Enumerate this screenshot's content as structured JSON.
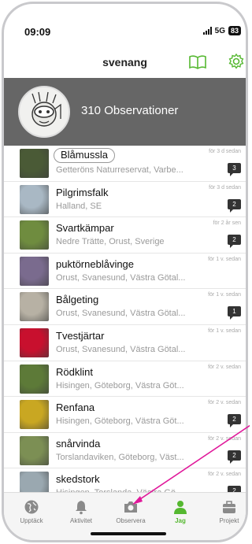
{
  "status": {
    "time": "09:09",
    "network": "5G",
    "battery": "83"
  },
  "header": {
    "title": "svenang"
  },
  "profile": {
    "observations": "310 Observationer"
  },
  "observations": [
    {
      "name": "Blåmussla",
      "place": "Getteröns Naturreservat, Varbe...",
      "ago": "för 3 d sedan",
      "comments": "3",
      "highlighted": true,
      "thumb": "#4a5a36"
    },
    {
      "name": "Pilgrimsfalk",
      "place": "Halland, SE",
      "ago": "för 3 d sedan",
      "comments": "2",
      "thumb": "#a9b8c4"
    },
    {
      "name": "Svartkämpar",
      "place": "Nedre Trätte, Orust, Sverige",
      "ago": "för 2 år sen",
      "comments": "2",
      "thumb": "#6f8c3f"
    },
    {
      "name": "puktörneblåvinge",
      "place": "Orust, Svanesund, Västra Götal...",
      "ago": "för 1 v. sedan",
      "comments": "",
      "thumb": "#7a6b8e"
    },
    {
      "name": "Bålgeting",
      "place": "Orust, Svanesund, Västra Götal...",
      "ago": "för 1 v. sedan",
      "comments": "1",
      "thumb": "#b7b1a4"
    },
    {
      "name": "Tvestjärtar",
      "place": "Orust, Svanesund, Västra Götal...",
      "ago": "för 1 v. sedan",
      "comments": "",
      "thumb": "#c8102e"
    },
    {
      "name": "Rödklint",
      "place": "Hisingen, Göteborg, Västra Göt...",
      "ago": "för 2 v. sedan",
      "comments": "",
      "thumb": "#5d7a38"
    },
    {
      "name": "Renfana",
      "place": "Hisingen, Göteborg, Västra Göt...",
      "ago": "för 2 v. sedan",
      "comments": "2",
      "thumb": "#c9a722"
    },
    {
      "name": "snårvinda",
      "place": "Torslandaviken, Göteborg, Väst...",
      "ago": "för 2 v. sedan",
      "comments": "2",
      "thumb": "#7c8f54"
    },
    {
      "name": "skedstork",
      "place": "Hisingen, Torslanda, Västra Gö...",
      "ago": "för 2 v. sedan",
      "comments": "2",
      "thumb": "#9aa8b0"
    }
  ],
  "tabs": [
    {
      "label": "Upptäck",
      "icon": "globe-icon"
    },
    {
      "label": "Aktivitet",
      "icon": "bell-icon"
    },
    {
      "label": "Observera",
      "icon": "camera-icon"
    },
    {
      "label": "Jag",
      "icon": "person-icon",
      "active": true
    },
    {
      "label": "Projekt",
      "icon": "briefcase-icon"
    }
  ],
  "colors": {
    "accent": "#55b830",
    "profile_bg": "#666666",
    "annotation": "#e0189a"
  }
}
